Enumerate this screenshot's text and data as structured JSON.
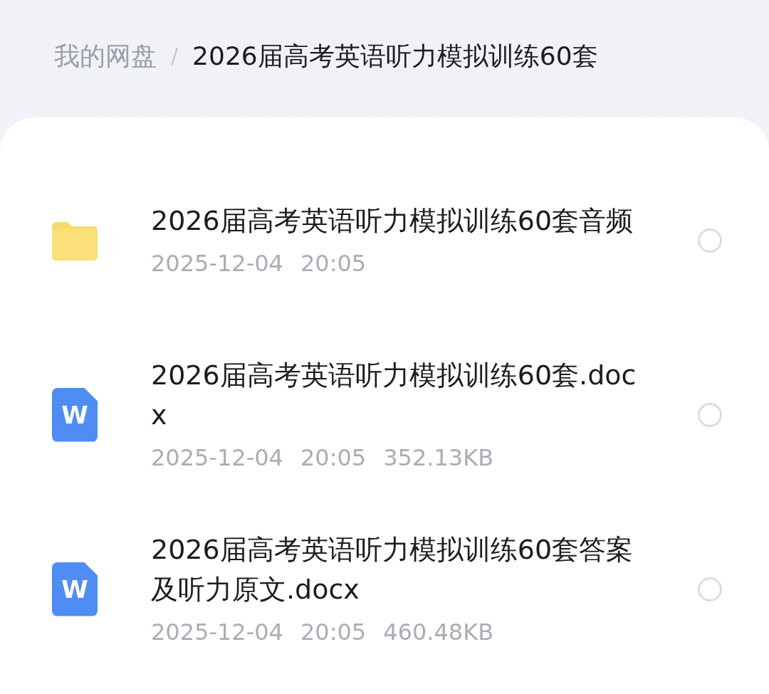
{
  "breadcrumb": [
    {
      "label": "我的网盘",
      "current": false
    },
    {
      "label": "2026届高考英语听力模拟训练60套",
      "current": true
    }
  ],
  "breadcrumb_separator": "/",
  "files": [
    {
      "kind": "folder",
      "name": "2026届高考英语听力模拟训练60套音频",
      "date": "2025-12-04",
      "time": "20:05",
      "selected": false
    },
    {
      "kind": "word",
      "icon_letter": "W",
      "name": "2026届高考英语听力模拟训练60套.docx",
      "date": "2025-12-04",
      "time": "20:05",
      "size": "352.13KB",
      "selected": false
    },
    {
      "kind": "word",
      "icon_letter": "W",
      "name": "2026届高考英语听力模拟训练60套答案及听力原文.docx",
      "date": "2025-12-04",
      "time": "20:05",
      "size": "460.48KB",
      "selected": false
    }
  ]
}
